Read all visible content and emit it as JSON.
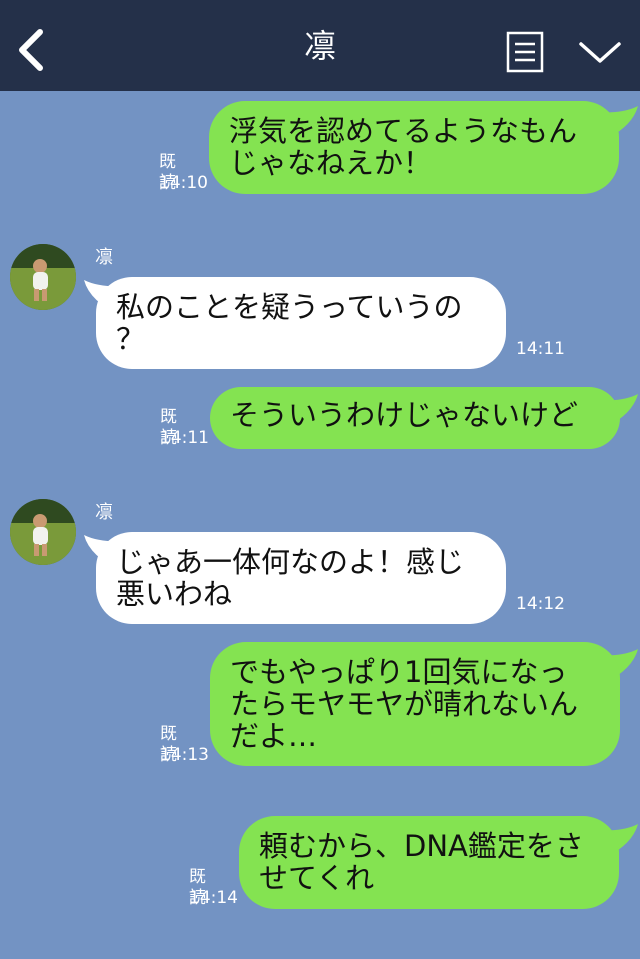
{
  "header": {
    "title": "凛",
    "bg_color": "#243049"
  },
  "colors": {
    "background": "#7393c3",
    "sent_bubble": "#84e351",
    "received_bubble": "#ffffff"
  },
  "messages": [
    {
      "direction": "sent",
      "text": "浮気を認めてるようなもん\nじゃなねえか！",
      "read": "既読",
      "time": "14:10"
    },
    {
      "direction": "received",
      "sender": "凛",
      "text": "私のことを疑うっていうの\n？",
      "time": "14:11"
    },
    {
      "direction": "sent",
      "text": "そういうわけじゃないけど",
      "read": "既読",
      "time": "14:11"
    },
    {
      "direction": "received",
      "sender": "凛",
      "text": "じゃあ一体何なのよ！感じ\n悪いわね",
      "time": "14:12"
    },
    {
      "direction": "sent",
      "text": "でもやっぱり1回気になっ\nたらモヤモヤが晴れないん\nだよ…",
      "read": "既読",
      "time": "14:13"
    },
    {
      "direction": "sent",
      "text": "頼むから、DNA鑑定をさ\nせてくれ",
      "read": "既読",
      "time": "14:14"
    }
  ]
}
